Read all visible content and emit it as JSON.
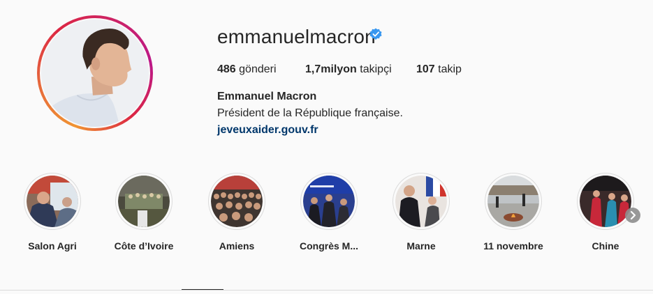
{
  "profile": {
    "username": "emmanuelmacron",
    "verified_icon": "verified-badge-icon",
    "full_name": "Emmanuel Macron",
    "bio": "Président de la République française.",
    "link": "jeveuxaider.gouv.fr"
  },
  "stats": {
    "posts_count": "486",
    "posts_label": "gönderi",
    "followers_count": "1,7milyon",
    "followers_label": "takipçi",
    "following_count": "107",
    "following_label": "takip"
  },
  "highlights": [
    {
      "label": "Salon Agri"
    },
    {
      "label": "Côte d’Ivoire"
    },
    {
      "label": "Amiens"
    },
    {
      "label": "Congrès M..."
    },
    {
      "label": "Marne"
    },
    {
      "label": "11 novembre"
    },
    {
      "label": "Chine"
    }
  ],
  "colors": {
    "link": "#00376b",
    "verified": "#3897f0",
    "text": "#262626"
  }
}
